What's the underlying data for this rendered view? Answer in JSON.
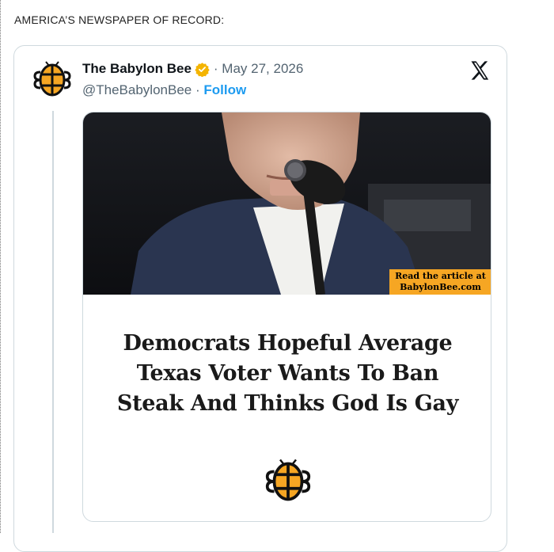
{
  "post": {
    "headline": "AMERICA’S NEWSPAPER OF RECORD:"
  },
  "tweet": {
    "author_name": "The Babylon Bee",
    "date_prefix": "· May 27, 2026",
    "handle": "@TheBabylonBee",
    "separator": "·",
    "follow_label": "Follow",
    "verified_badge_color": "#f4b400",
    "follow_color": "#1d9bf0",
    "icons": [
      "babylon-bee-avatar-icon",
      "verified-badge-icon",
      "x-logo-icon"
    ]
  },
  "embed": {
    "cta_line1": "Read the article at",
    "cta_line2": "BabylonBee.com",
    "title_lines": [
      "Democrats Hopeful Average",
      "Texas Voter Wants To Ban",
      "Steak And Thinks God Is Gay"
    ],
    "cta_color": "#f6a623"
  }
}
